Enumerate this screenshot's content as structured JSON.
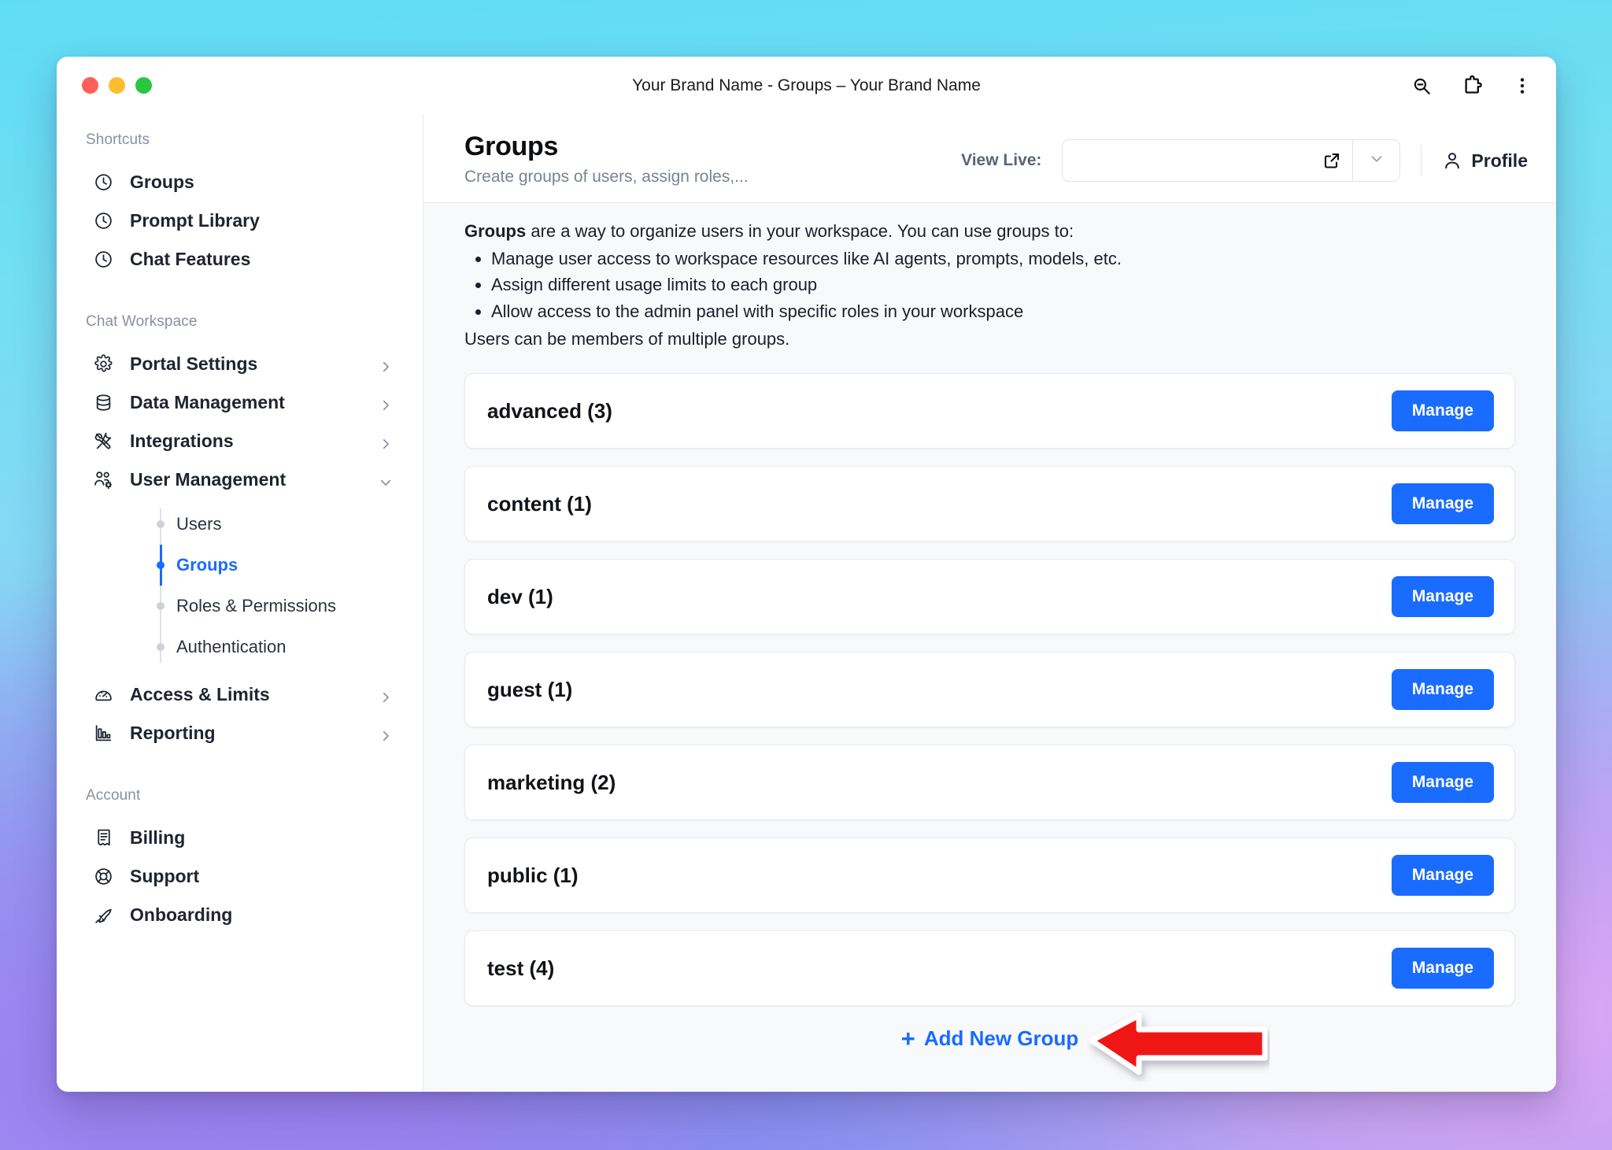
{
  "window": {
    "title": "Your Brand Name - Groups – Your Brand Name",
    "traffic": {
      "close": "close-window",
      "minimize": "minimize-window",
      "maximize": "maximize-window"
    },
    "toolbar_icons": [
      "zoom-out-icon",
      "extensions-icon",
      "browser-menu-icon"
    ]
  },
  "sidebar": {
    "sections": [
      {
        "label": "Shortcuts",
        "items": [
          {
            "label": "Groups",
            "icon": "clock-icon",
            "expandable": false
          },
          {
            "label": "Prompt Library",
            "icon": "clock-icon",
            "expandable": false
          },
          {
            "label": "Chat Features",
            "icon": "clock-icon",
            "expandable": false
          }
        ]
      },
      {
        "label": "Chat Workspace",
        "items": [
          {
            "label": "Portal Settings",
            "icon": "gear-icon",
            "expandable": true
          },
          {
            "label": "Data Management",
            "icon": "database-icon",
            "expandable": true
          },
          {
            "label": "Integrations",
            "icon": "tools-icon",
            "expandable": true
          },
          {
            "label": "User Management",
            "icon": "users-cog-icon",
            "expandable": true,
            "expanded": true,
            "children": [
              {
                "label": "Users",
                "active": false
              },
              {
                "label": "Groups",
                "active": true
              },
              {
                "label": "Roles & Permissions",
                "active": false
              },
              {
                "label": "Authentication",
                "active": false
              }
            ]
          },
          {
            "label": "Access & Limits",
            "icon": "gauge-icon",
            "expandable": true
          },
          {
            "label": "Reporting",
            "icon": "bar-chart-icon",
            "expandable": true
          }
        ]
      },
      {
        "label": "Account",
        "items": [
          {
            "label": "Billing",
            "icon": "receipt-icon",
            "expandable": false
          },
          {
            "label": "Support",
            "icon": "life-buoy-icon",
            "expandable": false
          },
          {
            "label": "Onboarding",
            "icon": "rocket-icon",
            "expandable": false
          }
        ]
      }
    ]
  },
  "header": {
    "title": "Groups",
    "subtitle": "Create groups of users, assign roles,...",
    "view_live_label": "View Live:",
    "view_live_value": "",
    "view_live_placeholder": "",
    "profile_label": "Profile"
  },
  "intro": {
    "lead_bold": "Groups",
    "lead_rest": " are a way to organize users in your workspace. You can use groups to:",
    "bullets": [
      "Manage user access to workspace resources like AI agents, prompts, models, etc.",
      "Assign different usage limits to each group",
      "Allow access to the admin panel with specific roles in your workspace"
    ],
    "tail": "Users can be members of multiple groups."
  },
  "groups": {
    "manage_label": "Manage",
    "items": [
      {
        "name": "advanced (3)"
      },
      {
        "name": "content (1)"
      },
      {
        "name": "dev (1)"
      },
      {
        "name": "guest (1)"
      },
      {
        "name": "marketing (2)"
      },
      {
        "name": "public (1)"
      },
      {
        "name": "test (4)"
      }
    ],
    "add_label": "Add New Group",
    "add_plus": "+"
  },
  "annotation": {
    "arrow": "red-left-arrow",
    "color": "#ef1414"
  },
  "colors": {
    "accent": "#1a6bff",
    "annotation_red": "#ef1414",
    "card_bg": "#ffffff",
    "page_bg": "#f7f9fb"
  }
}
